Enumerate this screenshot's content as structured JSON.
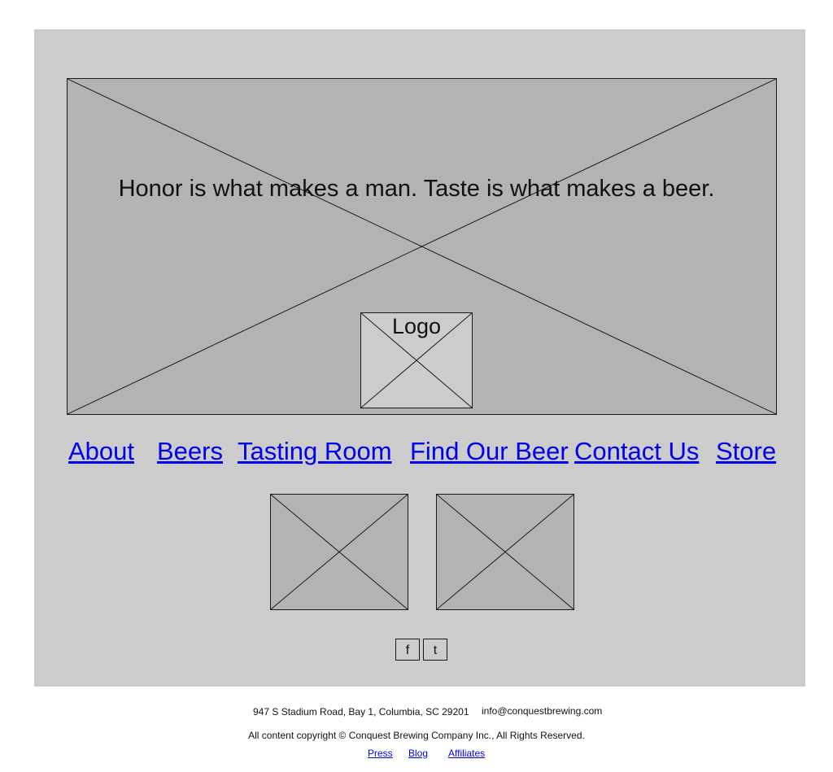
{
  "hero": {
    "tagline": "Honor is what makes a man. Taste is what makes a beer.",
    "logo_label": "Logo"
  },
  "nav": {
    "items": [
      {
        "label": "About"
      },
      {
        "label": "Beers"
      },
      {
        "label": "Tasting Room"
      },
      {
        "label": "Find Our Beer"
      },
      {
        "label": "Contact Us"
      },
      {
        "label": "Store"
      }
    ]
  },
  "social": {
    "facebook": "f",
    "twitter": "t"
  },
  "footer": {
    "address": "947 S Stadium Road, Bay 1, Columbia, SC 29201",
    "email": "info@conquestbrewing.com",
    "copyright": "All content copyright © Conquest Brewing Company Inc., All Rights Reserved.",
    "links": [
      {
        "label": "Press"
      },
      {
        "label": "Blog"
      },
      {
        "label": "Affiliates"
      }
    ]
  },
  "colors": {
    "panel": "#cccccc",
    "placeholder": "#b3b3b3",
    "link": "#0000ee"
  }
}
